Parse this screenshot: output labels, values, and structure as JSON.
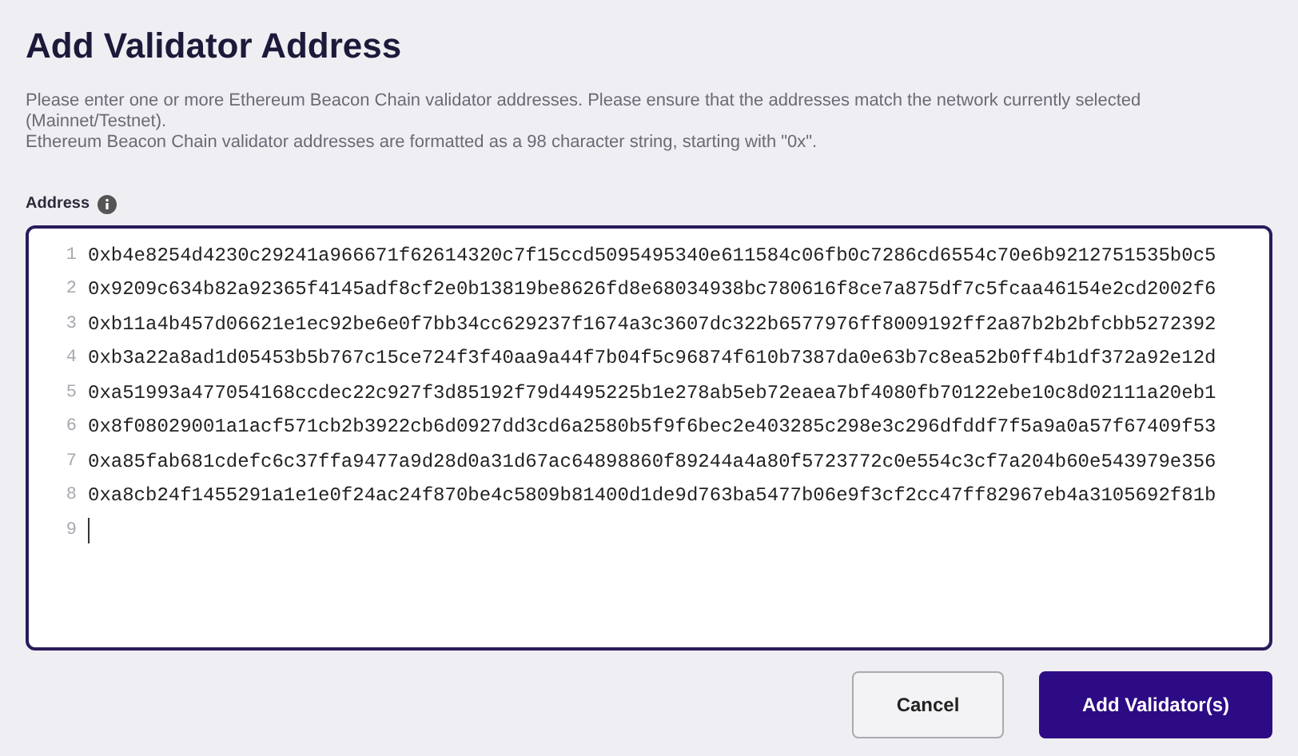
{
  "dialog": {
    "title": "Add Validator Address",
    "description": [
      "Please enter one or more Ethereum Beacon Chain validator addresses. Please ensure that the addresses match the network currently selected (Mainnet/Testnet).",
      "Ethereum Beacon Chain validator addresses are formatted as a 98 character string, starting with \"0x\"."
    ],
    "field_label": "Address",
    "lines": [
      {
        "number": "1",
        "text": "0xb4e8254d4230c29241a966671f62614320c7f15ccd5095495340e611584c06fb0c7286cd6554c70e6b9212751535b0c5",
        "cursor": false
      },
      {
        "number": "2",
        "text": "0x9209c634b82a92365f4145adf8cf2e0b13819be8626fd8e68034938bc780616f8ce7a875df7c5fcaa46154e2cd2002f6",
        "cursor": false
      },
      {
        "number": "3",
        "text": "0xb11a4b457d06621e1ec92be6e0f7bb34cc629237f1674a3c3607dc322b6577976ff8009192ff2a87b2b2bfcbb5272392",
        "cursor": false
      },
      {
        "number": "4",
        "text": "0xb3a22a8ad1d05453b5b767c15ce724f3f40aa9a44f7b04f5c96874f610b7387da0e63b7c8ea52b0ff4b1df372a92e12d",
        "cursor": false
      },
      {
        "number": "5",
        "text": "0xa51993a477054168ccdec22c927f3d85192f79d4495225b1e278ab5eb72eaea7bf4080fb70122ebe10c8d02111a20eb1",
        "cursor": false
      },
      {
        "number": "6",
        "text": "0x8f08029001a1acf571cb2b3922cb6d0927dd3cd6a2580b5f9f6bec2e403285c298e3c296dfddf7f5a9a0a57f67409f53",
        "cursor": false
      },
      {
        "number": "7",
        "text": "0xa85fab681cdefc6c37ffa9477a9d28d0a31d67ac64898860f89244a4a80f5723772c0e554c3cf7a204b60e543979e356",
        "cursor": false
      },
      {
        "number": "8",
        "text": "0xa8cb24f1455291a1e1e0f24ac24f870be4c5809b81400d1de9d763ba5477b06e9f3cf2cc47ff82967eb4a3105692f81b",
        "cursor": false
      },
      {
        "number": "9",
        "cursor": true
      }
    ],
    "buttons": [
      {
        "label": "Cancel",
        "kind": "secondary"
      },
      {
        "label": "Add Validator(s)",
        "kind": "primary"
      }
    ]
  }
}
